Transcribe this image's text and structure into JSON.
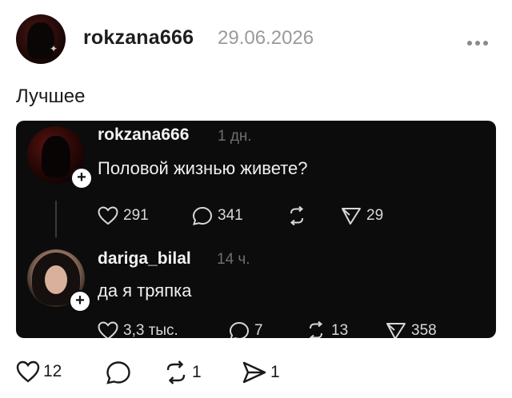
{
  "post": {
    "author": "rokzana666",
    "date": "29.06.2026",
    "caption": "Лучшее"
  },
  "quoted": {
    "comment1": {
      "author": "rokzana666",
      "time": "1 дн.",
      "text": "Половой жизнью живете?",
      "likes": "291",
      "replies": "341"
    },
    "comment1_share": "29",
    "comment2": {
      "author": "dariga_bilal",
      "time": "14 ч.",
      "text": "да я тряпка",
      "likes": "3,3 тыс.",
      "replies": "7",
      "reposts": "13",
      "shares": "358"
    }
  },
  "actions": {
    "likes": "12",
    "reposts": "1",
    "shares": "1"
  },
  "icons": [
    "avatar",
    "more-icon",
    "heart-icon",
    "comment-icon",
    "repost-icon",
    "share-icon",
    "plus-icon"
  ],
  "colors": {
    "card_bg": "#0c0c0c",
    "muted": "#9a9a9a"
  }
}
